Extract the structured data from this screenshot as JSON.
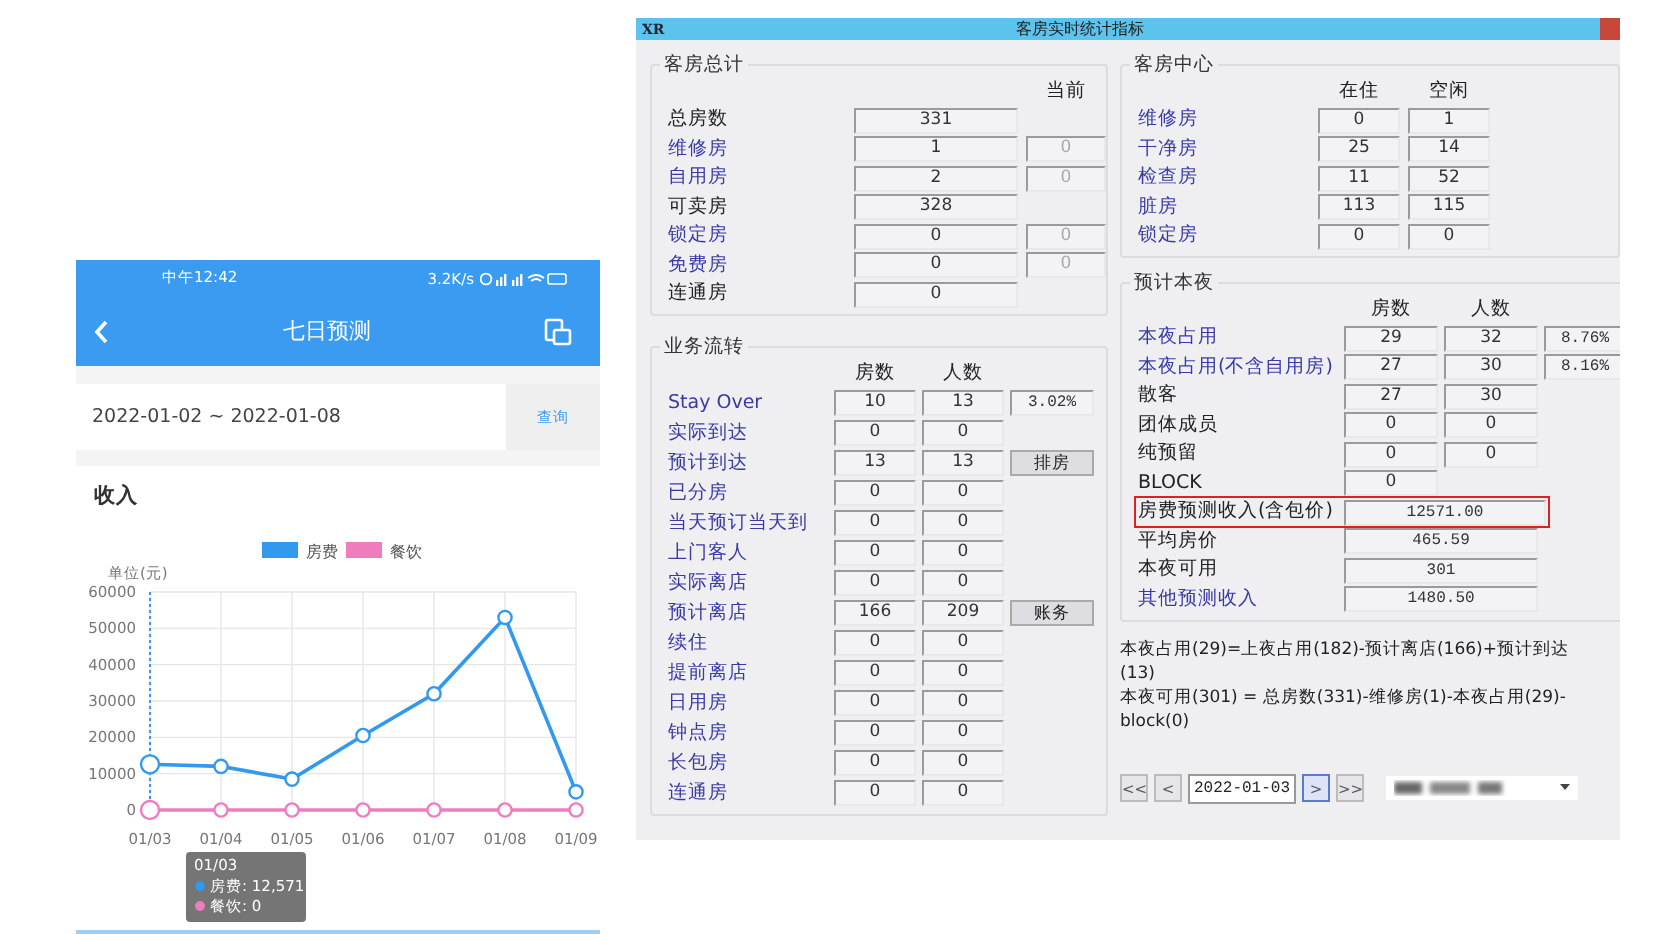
{
  "phone": {
    "status_bar": {
      "time": "中午12:42",
      "speed": "3.2K/s"
    },
    "title": "七日预测",
    "date_range": "2022-01-02 ~ 2022-01-08",
    "query_button": "查询",
    "section_title": "收入",
    "chart_data": {
      "type": "line",
      "ylabel": "单位(元)",
      "grid": true,
      "legend": true,
      "categories": [
        "01/03",
        "01/04",
        "01/05",
        "01/06",
        "01/07",
        "01/08",
        "01/09"
      ],
      "yticks": [
        0,
        10000,
        20000,
        30000,
        40000,
        50000,
        60000
      ],
      "ylim": [
        0,
        60000
      ],
      "series": [
        {
          "name": "房费",
          "color": "#3399ee",
          "marker": "circle",
          "values": [
            12571,
            12000,
            8500,
            20500,
            32000,
            53000,
            5000
          ]
        },
        {
          "name": "餐饮",
          "color": "#f07cc0",
          "marker": "circle",
          "values": [
            0,
            0,
            0,
            0,
            0,
            0,
            0
          ]
        }
      ]
    },
    "tooltip": {
      "title": "01/03",
      "lines": [
        {
          "text": "房费: 12,571",
          "color": "#3399ee"
        },
        {
          "text": "餐饮: 0",
          "color": "#f07cc0"
        }
      ]
    }
  },
  "window": {
    "logo": "XR",
    "title": "客房实时统计指标",
    "room_total": {
      "title": "客房总计",
      "header": "当前",
      "rows": [
        {
          "label": "总房数",
          "linked": false,
          "value": "331"
        },
        {
          "label": "维修房",
          "linked": true,
          "value": "1",
          "current": "0"
        },
        {
          "label": "自用房",
          "linked": true,
          "value": "2",
          "current": "0"
        },
        {
          "label": "可卖房",
          "linked": false,
          "value": "328"
        },
        {
          "label": "锁定房",
          "linked": true,
          "value": "0",
          "current": "0"
        },
        {
          "label": "免费房",
          "linked": true,
          "value": "0",
          "current": "0"
        },
        {
          "label": "连通房",
          "linked": false,
          "value": "0"
        }
      ]
    },
    "business_flow": {
      "title": "业务流转",
      "headers": [
        "房数",
        "人数"
      ],
      "rows": [
        {
          "label": "Stay Over",
          "linked": true,
          "rooms": "10",
          "guests": "13",
          "extra": "3.02%"
        },
        {
          "label": "实际到达",
          "linked": true,
          "rooms": "0",
          "guests": "0"
        },
        {
          "label": "预计到达",
          "linked": true,
          "rooms": "13",
          "guests": "13",
          "button": "排房"
        },
        {
          "label": "已分房",
          "linked": true,
          "rooms": "0",
          "guests": "0"
        },
        {
          "label": "当天预订当天到",
          "linked": true,
          "rooms": "0",
          "guests": "0"
        },
        {
          "label": "上门客人",
          "linked": true,
          "rooms": "0",
          "guests": "0"
        },
        {
          "label": "实际离店",
          "linked": true,
          "rooms": "0",
          "guests": "0"
        },
        {
          "label": "预计离店",
          "linked": true,
          "rooms": "166",
          "guests": "209",
          "button": "账务"
        },
        {
          "label": "续住",
          "linked": true,
          "rooms": "0",
          "guests": "0"
        },
        {
          "label": "提前离店",
          "linked": true,
          "rooms": "0",
          "guests": "0"
        },
        {
          "label": "日用房",
          "linked": true,
          "rooms": "0",
          "guests": "0"
        },
        {
          "label": "钟点房",
          "linked": true,
          "rooms": "0",
          "guests": "0"
        },
        {
          "label": "长包房",
          "linked": true,
          "rooms": "0",
          "guests": "0"
        },
        {
          "label": "连通房",
          "linked": true,
          "rooms": "0",
          "guests": "0"
        }
      ]
    },
    "room_center": {
      "title": "客房中心",
      "headers": [
        "在住",
        "空闲"
      ],
      "rows": [
        {
          "label": "维修房",
          "linked": true,
          "occupied": "0",
          "vacant": "1"
        },
        {
          "label": "干净房",
          "linked": true,
          "occupied": "25",
          "vacant": "14"
        },
        {
          "label": "检查房",
          "linked": true,
          "occupied": "11",
          "vacant": "52"
        },
        {
          "label": "脏房",
          "linked": true,
          "occupied": "113",
          "vacant": "115"
        },
        {
          "label": "锁定房",
          "linked": true,
          "occupied": "0",
          "vacant": "0"
        }
      ]
    },
    "tonight": {
      "title": "预计本夜",
      "headers": [
        "房数",
        "人数"
      ],
      "rows": [
        {
          "label": "本夜占用",
          "linked": true,
          "highlighted": false,
          "rooms": "29",
          "guests": "32",
          "extra": "8.76%"
        },
        {
          "label": "本夜占用(不含自用房)",
          "linked": true,
          "highlighted": false,
          "rooms": "27",
          "guests": "30",
          "extra": "8.16%"
        },
        {
          "label": "散客",
          "linked": false,
          "highlighted": false,
          "rooms": "27",
          "guests": "30"
        },
        {
          "label": "团体成员",
          "linked": false,
          "highlighted": false,
          "rooms": "0",
          "guests": "0"
        },
        {
          "label": "纯预留",
          "linked": false,
          "highlighted": false,
          "rooms": "0",
          "guests": "0"
        },
        {
          "label": "BLOCK",
          "linked": false,
          "highlighted": false,
          "rooms": "0"
        },
        {
          "label": "房费预测收入(含包价)",
          "linked": false,
          "highlighted": true,
          "value": "12571.00"
        },
        {
          "label": "平均房价",
          "linked": false,
          "highlighted": false,
          "value": "465.59"
        },
        {
          "label": "本夜可用",
          "linked": false,
          "highlighted": false,
          "value": "301"
        },
        {
          "label": "其他预测收入",
          "linked": true,
          "highlighted": false,
          "value": "1480.50"
        }
      ]
    },
    "formulas": [
      "本夜占用(29)=上夜占用(182)-预计离店(166)+预计到达(13)",
      "本夜可用(301) = 总房数(331)-维修房(1)-本夜占用(29)-block(0)"
    ],
    "nav": [
      {
        "kind": "button",
        "label": "<<",
        "selected": false
      },
      {
        "kind": "button",
        "label": "<",
        "selected": false
      },
      {
        "kind": "date",
        "label": "2022-01-03"
      },
      {
        "kind": "button",
        "label": ">",
        "selected": true
      },
      {
        "kind": "button",
        "label": ">>",
        "selected": false
      },
      {
        "kind": "dropdown"
      }
    ]
  }
}
